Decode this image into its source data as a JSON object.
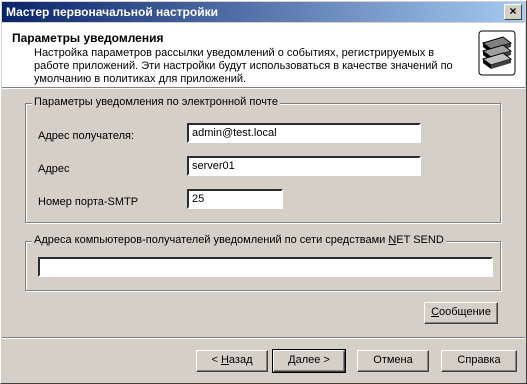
{
  "window": {
    "title": "Мастер первоначальной настройки",
    "close_glyph": "×"
  },
  "header": {
    "title": "Параметры уведомления",
    "description": "Настройка параметров рассылки уведомлений о событиях, регистрируемых в работе приложений. Эти настройки будут использоваться в качестве значений по умолчанию в политиках для приложений.",
    "icon": "books-stack-icon"
  },
  "email_group": {
    "legend": "Параметры уведомления по электронной почте",
    "recipient_label": "Адрес получателя:",
    "recipient_value": "admin@test.local",
    "address_label": "Адрес",
    "address_value": "server01",
    "port_label": "Номер порта-SMTP",
    "port_value": "25"
  },
  "netsend_group": {
    "legend_pre": "Адреса компьютеров-получателей уведомлений по сети средствами ",
    "legend_underlined": "N",
    "legend_post": "ET SEND",
    "value": ""
  },
  "buttons": {
    "message_pre": "",
    "message_u": "С",
    "message_post": "ообщение",
    "back_pre": "< ",
    "back_u": "Н",
    "back_post": "азад",
    "next_pre": "",
    "next_u": "Д",
    "next_post": "алее >",
    "cancel": "Отмена",
    "help": "Справка"
  }
}
